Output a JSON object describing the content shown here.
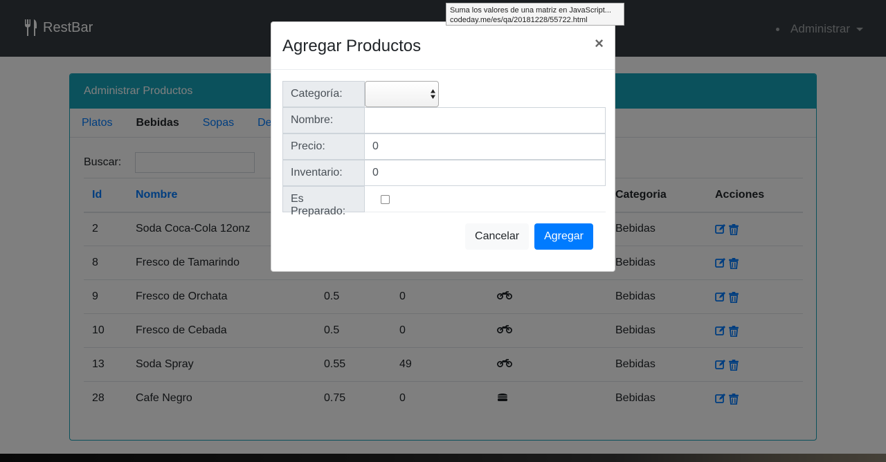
{
  "navbar": {
    "brand": "RestBar",
    "user_menu": "Administrar"
  },
  "card": {
    "header": "Administrar Productos"
  },
  "tabs": [
    "Platos",
    "Bebidas",
    "Sopas",
    "De"
  ],
  "search": {
    "label": "Buscar:",
    "value": ""
  },
  "table": {
    "headers": [
      "Id",
      "Nombre",
      "",
      "",
      "",
      "Categoria",
      "Acciones"
    ],
    "rows": [
      {
        "id": "2",
        "nombre": "Soda Coca-Cola 12onz",
        "precio": "",
        "inventario": "",
        "tipo_icon": "",
        "categoria": "Bebidas"
      },
      {
        "id": "8",
        "nombre": "Fresco de Tamarindo",
        "precio": "",
        "inventario": "",
        "tipo_icon": "",
        "categoria": "Bebidas"
      },
      {
        "id": "9",
        "nombre": "Fresco de Orchata",
        "precio": "0.5",
        "inventario": "0",
        "tipo_icon": "motorcycle-icon",
        "categoria": "Bebidas"
      },
      {
        "id": "10",
        "nombre": "Fresco de Cebada",
        "precio": "0.5",
        "inventario": "0",
        "tipo_icon": "motorcycle-icon",
        "categoria": "Bebidas"
      },
      {
        "id": "13",
        "nombre": "Soda Spray",
        "precio": "0.55",
        "inventario": "49",
        "tipo_icon": "motorcycle-icon",
        "categoria": "Bebidas"
      },
      {
        "id": "28",
        "nombre": "Cafe Negro",
        "precio": "0.75",
        "inventario": "0",
        "tipo_icon": "burger-icon",
        "categoria": "Bebidas"
      }
    ]
  },
  "modal": {
    "title": "Agregar Productos",
    "close": "×",
    "fields": {
      "categoria": {
        "label": "Categoría:",
        "value": ""
      },
      "nombre": {
        "label": "Nombre:",
        "value": ""
      },
      "precio": {
        "label": "Precio:",
        "value": "0"
      },
      "inventario": {
        "label": "Inventario:",
        "value": "0"
      },
      "preparado": {
        "label": "Es Preparado:",
        "checked": false
      }
    },
    "cancel": "Cancelar",
    "submit": "Agregar"
  },
  "tooltip": {
    "line1": "Suma los valores de una matriz en JavaScript...",
    "line2": "codeday.me/es/qa/20181228/55722.html"
  },
  "colors": {
    "navbar": "#343a40",
    "card_accent": "#17a2b8",
    "primary": "#007bff"
  }
}
